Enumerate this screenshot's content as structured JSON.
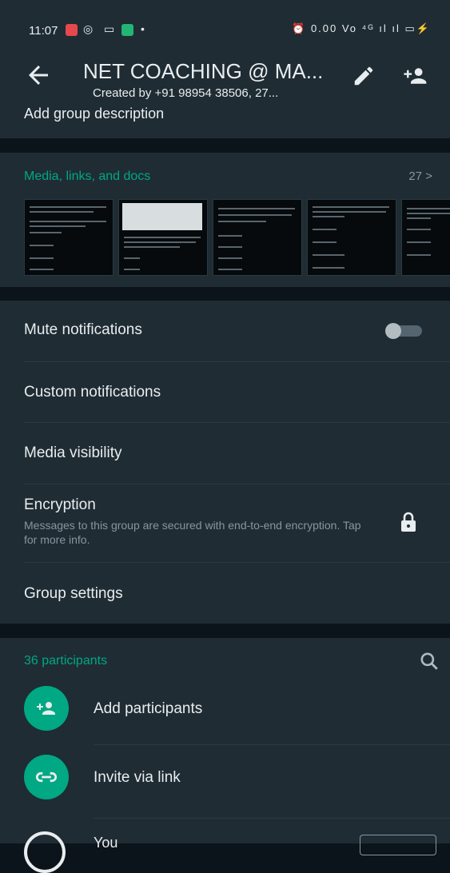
{
  "status_bar": {
    "time": "11:07",
    "right_text": "⏰ 0.00 Vo ⁴ᴳ ıl ıl ▭⚡"
  },
  "header": {
    "title": "NET COACHING @ MA...",
    "subtitle": "Created by +91 98954 38506, 27..."
  },
  "description": {
    "label": "Add group description"
  },
  "media": {
    "label": "Media, links, and docs",
    "count": "27 >"
  },
  "settings": {
    "mute": "Mute notifications",
    "custom": "Custom notifications",
    "visibility": "Media visibility",
    "encryption": "Encryption",
    "encryption_sub": "Messages to this group are secured with end-to-end encryption. Tap for more info.",
    "group_settings": "Group settings",
    "mute_enabled": false
  },
  "participants": {
    "count_label": "36 participants",
    "add_label": "Add participants",
    "invite_label": "Invite via link",
    "you_label": "You"
  },
  "colors": {
    "accent": "#00a884",
    "surface": "#1f2c34",
    "background": "#0b141a"
  }
}
